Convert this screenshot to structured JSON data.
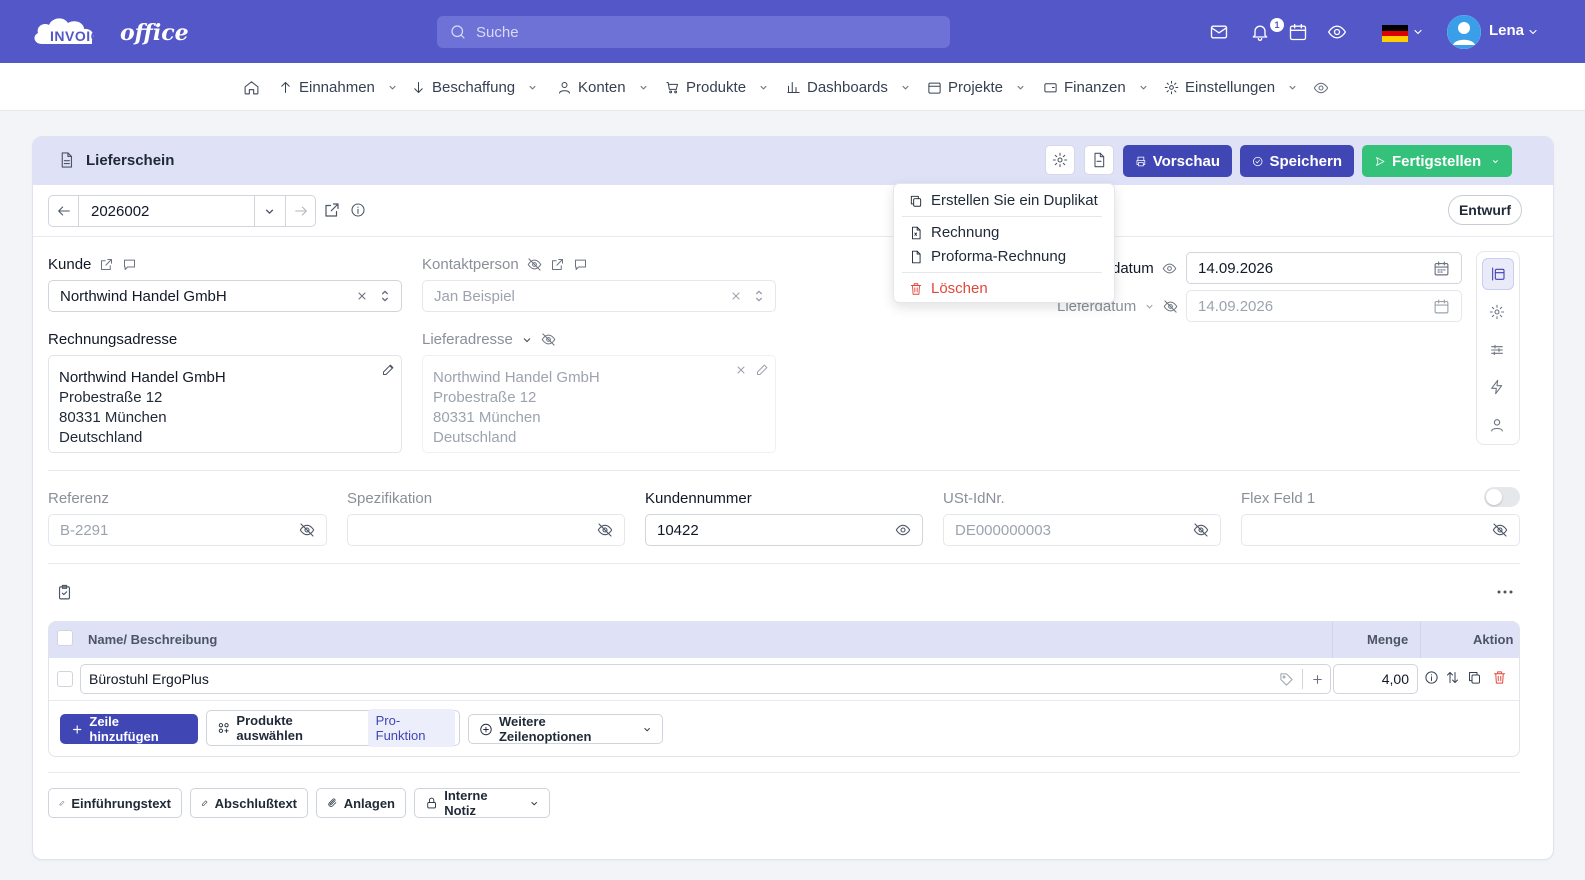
{
  "header": {
    "logo_word1": "INVOICE",
    "logo_word2": "office",
    "search_placeholder": "Suche",
    "notification_count": "1",
    "user_name": "Lena",
    "brand_color": "#5357c8"
  },
  "nav": {
    "items": [
      {
        "label": "Einnahmen",
        "icon": "arrow-up-icon"
      },
      {
        "label": "Beschaffung",
        "icon": "arrow-down-icon"
      },
      {
        "label": "Konten",
        "icon": "user-icon"
      },
      {
        "label": "Produkte",
        "icon": "cart-icon"
      },
      {
        "label": "Dashboards",
        "icon": "bar-chart-icon"
      },
      {
        "label": "Projekte",
        "icon": "calendar-icon"
      },
      {
        "label": "Finanzen",
        "icon": "wallet-icon"
      },
      {
        "label": "Einstellungen",
        "icon": "gear-icon"
      }
    ]
  },
  "card": {
    "title": "Lieferschein",
    "btn_preview": "Vorschau",
    "btn_save": "Speichern",
    "btn_finish": "Fertigstellen",
    "doc_number": "2026002",
    "status": "Entwurf"
  },
  "dropdown": {
    "items": [
      "Erstellen Sie ein Duplikat",
      "Rechnung",
      "Proforma-Rechnung",
      "Löschen"
    ]
  },
  "form": {
    "kunde_label": "Kunde",
    "kunde_value": "Northwind Handel GmbH",
    "kontakt_label": "Kontaktperson",
    "kontakt_value": "Jan Beispiel",
    "datum_label": "datum",
    "datum_value": "14.09.2026",
    "lieferdatum_label": "Lieferdatum",
    "lieferdatum_value": "14.09.2026",
    "rechnungsadresse_label": "Rechnungsadresse",
    "rechnungsadresse": [
      "Northwind Handel GmbH",
      "Probestraße 12",
      "80331 München",
      "Deutschland"
    ],
    "lieferadresse_label": "Lieferadresse",
    "lieferadresse": [
      "Northwind Handel GmbH",
      "Probestraße 12",
      "80331 München",
      "Deutschland"
    ],
    "referenz_label": "Referenz",
    "referenz_value": "B-2291",
    "spezifikation_label": "Spezifikation",
    "spezifikation_value": "",
    "kundennummer_label": "Kundennummer",
    "kundennummer_value": "10422",
    "ustid_label": "USt-IdNr.",
    "ustid_value": "DE000000003",
    "flex_label": "Flex Feld 1",
    "flex_value": ""
  },
  "table": {
    "col_name": "Name/ Beschreibung",
    "col_qty": "Menge",
    "col_action": "Aktion",
    "rows": [
      {
        "name": "Bürostuhl ErgoPlus",
        "qty": "4,00"
      }
    ],
    "btn_add_row": "Zeile hinzufügen",
    "btn_select_products": "Produkte auswählen",
    "pro_tag": "Pro-Funktion",
    "btn_more_options": "Weitere Zeilenoptionen"
  },
  "footer": {
    "btn_intro": "Einführungstext",
    "btn_closing": "Abschlußtext",
    "btn_attachments": "Anlagen",
    "btn_note": "Interne Notiz"
  }
}
